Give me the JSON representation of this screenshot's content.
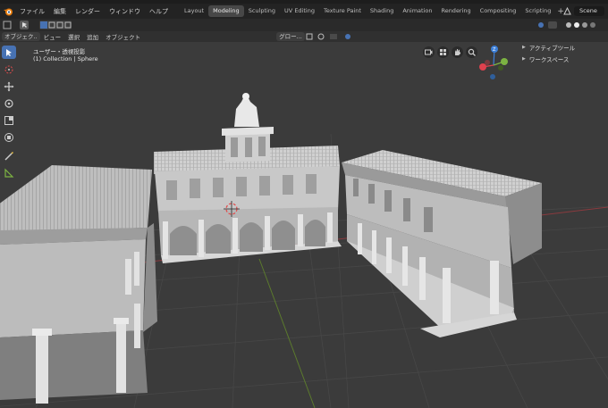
{
  "menu": {
    "items": [
      "ファイル",
      "編集",
      "レンダー",
      "ウィンドウ",
      "ヘルプ"
    ]
  },
  "workspaces": {
    "tabs": [
      "Layout",
      "Modeling",
      "Sculpting",
      "UV Editing",
      "Texture Paint",
      "Shading",
      "Animation",
      "Rendering",
      "Compositing",
      "Scripting"
    ],
    "active": "Modeling"
  },
  "scene": {
    "label": "Scene"
  },
  "header": {
    "mode_label": "オブジェク..",
    "view_label": "ビュー",
    "select_label": "選択",
    "add_label": "追加",
    "object_label": "オブジェクト",
    "orientation_label": "グロー..."
  },
  "viewport": {
    "view_mode": "ユーザー・透視投影",
    "collection_info": "(1) Collection | Sphere"
  },
  "side_panels": {
    "active_tool": "アクティブツール",
    "workspace": "ワークスペース"
  },
  "gizmo": {
    "z_label": "Z",
    "y_label": "Y",
    "x_label": "X",
    "colors": {
      "x": "#e0414e",
      "y": "#7cb342",
      "z": "#3c7fd8"
    }
  },
  "colors": {
    "accent": "#4772b3",
    "menu_bg": "#232323",
    "viewport_bg": "#3b3b3b"
  },
  "icons": [
    "blender-logo-icon",
    "select-box-icon",
    "cursor-icon",
    "move-icon",
    "rotate-icon",
    "scale-icon",
    "transform-icon",
    "annotate-icon",
    "measure-icon",
    "camera-icon",
    "hand-pan-icon",
    "zoom-icon",
    "grid-view-icon"
  ]
}
